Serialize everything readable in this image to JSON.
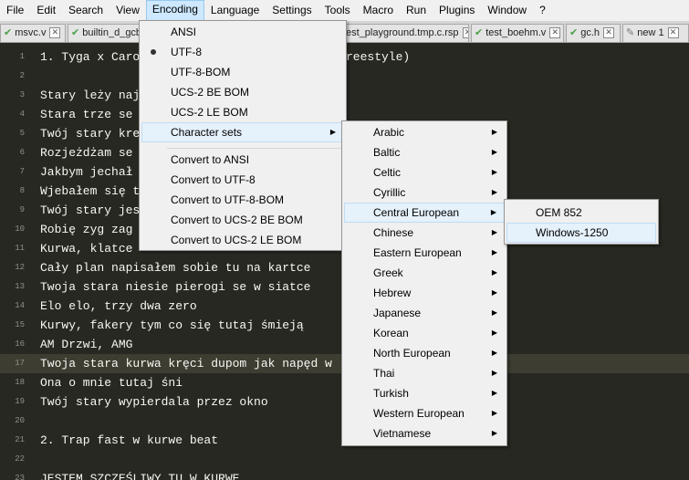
{
  "menubar": [
    "File",
    "Edit",
    "Search",
    "View",
    "Encoding",
    "Language",
    "Settings",
    "Tools",
    "Macro",
    "Run",
    "Plugins",
    "Window",
    "?"
  ],
  "tabs": [
    {
      "label": "msvc.v"
    },
    {
      "label": "builtin_d_gcb"
    },
    {
      "label": "est_playground.tmp.c.rsp"
    },
    {
      "label": "test_boehm.v"
    },
    {
      "label": "gc.h"
    },
    {
      "label": "new 1"
    }
  ],
  "editor": {
    "lines": [
      {
        "n": "1",
        "text": "1. Tyga x Caro"
      },
      {
        "n": "2",
        "text": ""
      },
      {
        "n": "3",
        "text": "Stary leży naj"
      },
      {
        "n": "4",
        "text": "Stara trze se"
      },
      {
        "n": "5",
        "text": "Twój stary kre"
      },
      {
        "n": "6",
        "text": "Rozjeżdżam se"
      },
      {
        "n": "7",
        "text": "Jakbym jechał"
      },
      {
        "n": "8",
        "text": "Wjebałem się t"
      },
      {
        "n": "9",
        "text": "Twój stary jes"
      },
      {
        "n": "10",
        "text": "Robię zyg zag"
      },
      {
        "n": "11",
        "text": "Kurwa, klatce"
      },
      {
        "n": "12",
        "text": "Cały plan napisałem sobie tu na kartce"
      },
      {
        "n": "13",
        "text": "Twoja stara niesie pierogi se w siatce"
      },
      {
        "n": "14",
        "text": "Elo elo, trzy dwa zero"
      },
      {
        "n": "15",
        "text": "Kurwy, fakery tym co się tutaj śmieją"
      },
      {
        "n": "16",
        "text": "AM Drzwi, AMG"
      },
      {
        "n": "17",
        "text": "Twoja stara kurwa kręci dupom jak napęd w"
      },
      {
        "n": "18",
        "text": "Ona o mnie tutaj śni"
      },
      {
        "n": "19",
        "text": "Twój stary wypierdala przez okno"
      },
      {
        "n": "20",
        "text": ""
      },
      {
        "n": "21",
        "text": "2. Trap fast w kurwe beat"
      },
      {
        "n": "22",
        "text": ""
      },
      {
        "n": "23",
        "text": "JESTEM SZCZĘŚLIWY TU W KURWE"
      }
    ],
    "line1_tail": "reestyle)"
  },
  "encoding_menu": {
    "items": [
      "ANSI",
      "UTF-8",
      "UTF-8-BOM",
      "UCS-2 BE BOM",
      "UCS-2 LE BOM",
      "Character sets",
      "Convert to ANSI",
      "Convert to UTF-8",
      "Convert to UTF-8-BOM",
      "Convert to UCS-2 BE BOM",
      "Convert to UCS-2 LE BOM"
    ],
    "selected": "UTF-8",
    "highlighted": "Character sets"
  },
  "charsets_menu": {
    "items": [
      "Arabic",
      "Baltic",
      "Celtic",
      "Cyrillic",
      "Central European",
      "Chinese",
      "Eastern European",
      "Greek",
      "Hebrew",
      "Japanese",
      "Korean",
      "North European",
      "Thai",
      "Turkish",
      "Western European",
      "Vietnamese"
    ],
    "highlighted": "Central European"
  },
  "central_european_menu": {
    "items": [
      "OEM 852",
      "Windows-1250"
    ],
    "highlighted": "Windows-1250"
  },
  "colors": {
    "editor_bg": "#272822",
    "text": "#f8f8f2",
    "line_number": "#8f908a",
    "current_line": "#3e3d32"
  }
}
